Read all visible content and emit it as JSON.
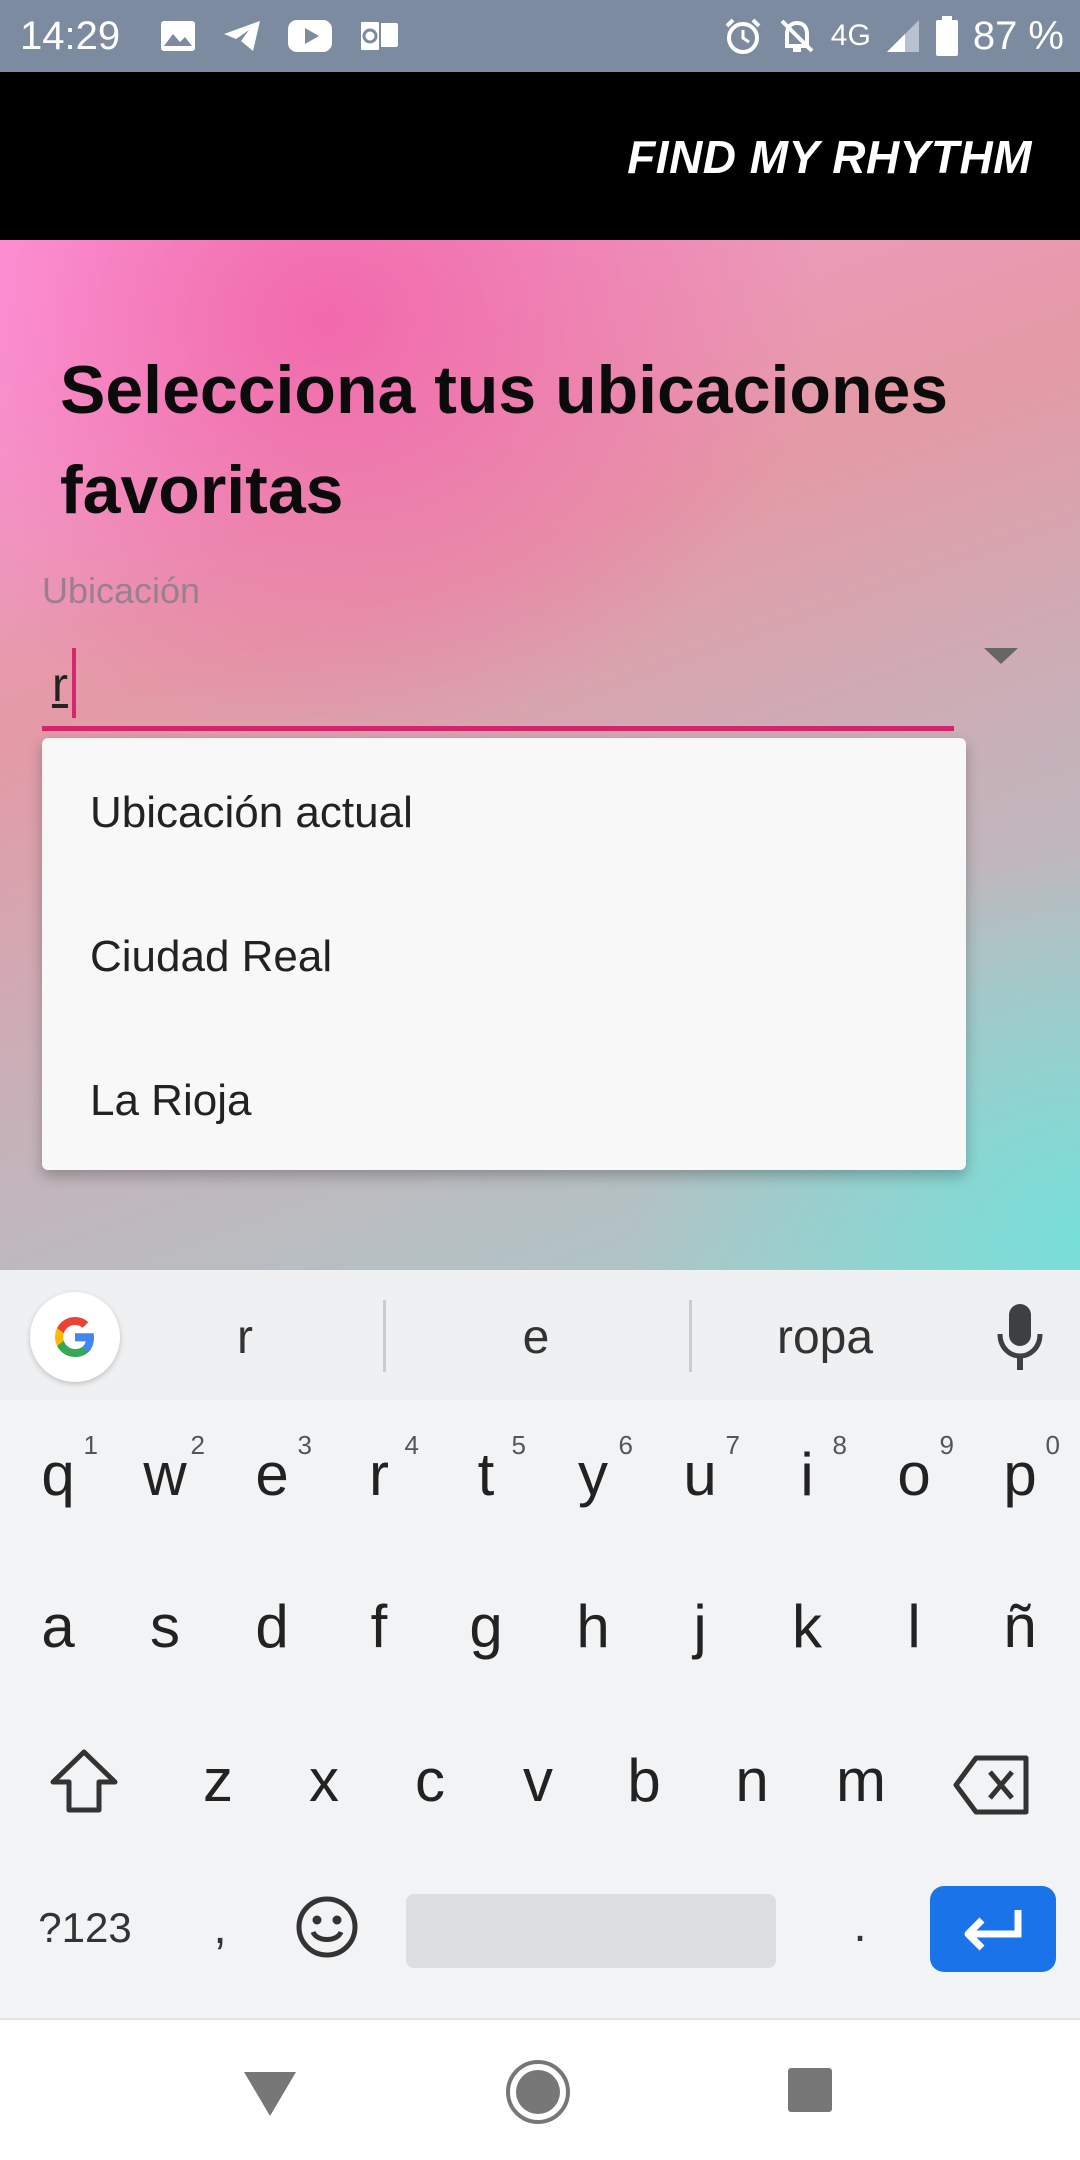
{
  "status_bar": {
    "time": "14:29",
    "network": "4G",
    "battery": "87 %",
    "left_icons": [
      "gallery-icon",
      "telegram-icon",
      "youtube-icon",
      "outlook-icon"
    ],
    "right_icons": [
      "alarm-icon",
      "bell-off-icon",
      "signal-icon",
      "battery-icon"
    ]
  },
  "app_bar": {
    "title": "FIND MY RHYTHM"
  },
  "main": {
    "heading": "Selecciona tus ubicaciones favoritas",
    "field": {
      "label": "Ubicación",
      "value": "r"
    },
    "dropdown": {
      "options": [
        "Ubicación actual",
        "Ciudad Real",
        "La Rioja"
      ]
    }
  },
  "keyboard": {
    "suggestions": [
      "r",
      "e",
      "ropa"
    ],
    "row1": [
      {
        "key": "q",
        "hint": "1"
      },
      {
        "key": "w",
        "hint": "2"
      },
      {
        "key": "e",
        "hint": "3"
      },
      {
        "key": "r",
        "hint": "4"
      },
      {
        "key": "t",
        "hint": "5"
      },
      {
        "key": "y",
        "hint": "6"
      },
      {
        "key": "u",
        "hint": "7"
      },
      {
        "key": "i",
        "hint": "8"
      },
      {
        "key": "o",
        "hint": "9"
      },
      {
        "key": "p",
        "hint": "0"
      }
    ],
    "row2": [
      "a",
      "s",
      "d",
      "f",
      "g",
      "h",
      "j",
      "k",
      "l",
      "ñ"
    ],
    "row3": [
      "z",
      "x",
      "c",
      "v",
      "b",
      "n",
      "m"
    ],
    "symbols_label": "?123",
    "comma": ",",
    "period": ".",
    "accent_color": "#1a73e8"
  },
  "colors": {
    "accent": "#d4246a",
    "status_bar": "#7d8ba0",
    "app_bar": "#000000"
  }
}
